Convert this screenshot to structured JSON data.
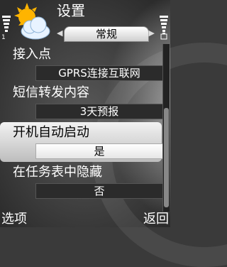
{
  "header": {
    "title": "设置",
    "tab_label": "常规"
  },
  "settings": [
    {
      "label": "接入点",
      "value": "GPRS连接互联网"
    },
    {
      "label": "短信转发内容",
      "value": "3天预报"
    },
    {
      "label": "开机自动启动",
      "value": "是",
      "selected": true
    },
    {
      "label": "在任务表中隐藏",
      "value": "否"
    }
  ],
  "softkeys": {
    "left": "选项",
    "right": "返回"
  },
  "icons": {
    "app": "weather-sun-cloud-icon",
    "signal": "signal-strength-icon",
    "battery": "battery-level-icon",
    "tab_prev": "tab-left-arrow-icon",
    "tab_next": "tab-right-arrow-icon"
  }
}
